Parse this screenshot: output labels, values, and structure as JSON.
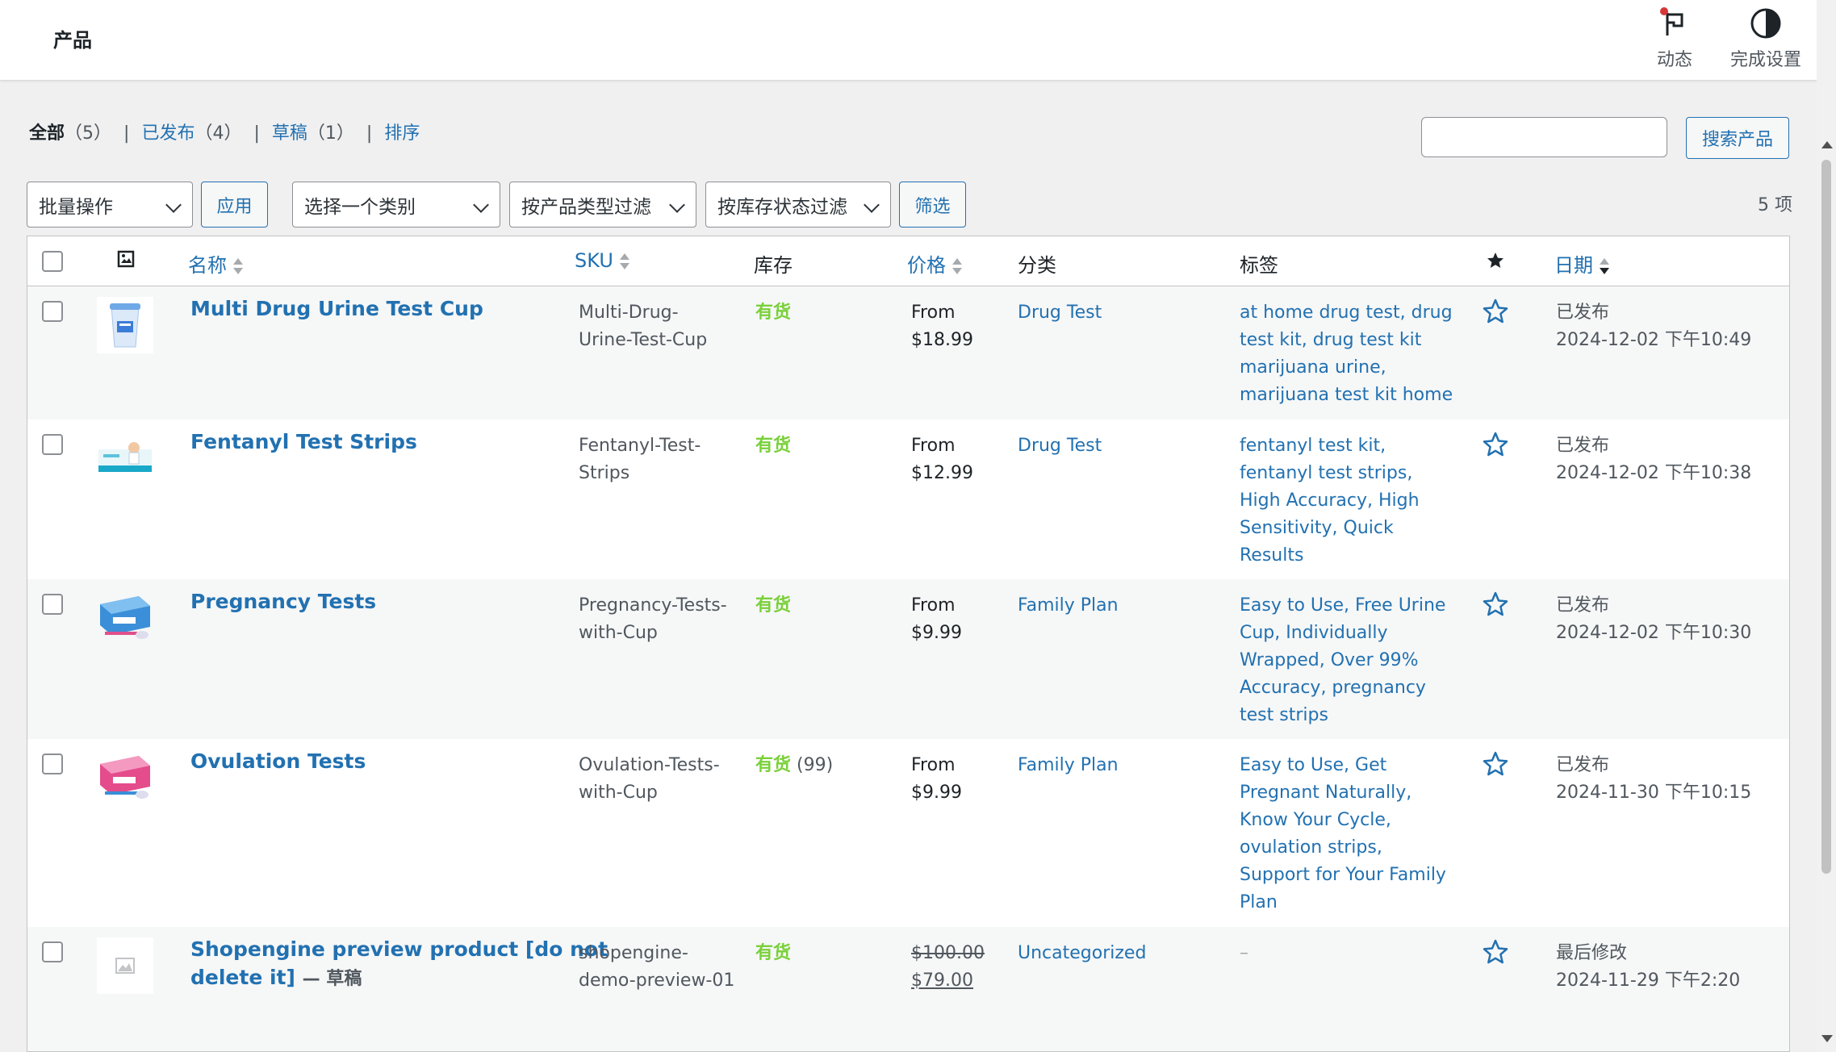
{
  "header": {
    "title": "产品",
    "actions": [
      {
        "label": "动态",
        "icon": "flag-icon"
      },
      {
        "label": "完成设置",
        "icon": "half-circle-icon"
      }
    ]
  },
  "views": {
    "all": {
      "label": "全部",
      "count": "（5）"
    },
    "published": {
      "label": "已发布",
      "count": "（4）"
    },
    "draft": {
      "label": "草稿",
      "count": "（1）"
    },
    "sort": {
      "label": "排序"
    },
    "separator": "|"
  },
  "search": {
    "placeholder": "",
    "button": "搜索产品"
  },
  "filters": {
    "bulk_action": "批量操作",
    "apply": "应用",
    "category": "选择一个类别",
    "product_type": "按产品类型过滤",
    "stock_status": "按库存状态过滤",
    "filter": "筛选",
    "items_count": "5 项"
  },
  "table": {
    "columns": {
      "name": "名称",
      "sku": "SKU",
      "stock": "库存",
      "price": "价格",
      "category": "分类",
      "tags": "标签",
      "date": "日期"
    },
    "rows": [
      {
        "name": "Multi Drug Urine Test Cup",
        "sku": [
          "Multi-Drug-",
          "Urine-Test-Cup"
        ],
        "stock": "有货",
        "stock_qty": "",
        "price": [
          "From",
          "$18.99"
        ],
        "category": "Drug Test",
        "tags": [
          "at home drug test, drug",
          "test kit, drug test kit",
          "marijuana urine,",
          "marijuana test kit home"
        ],
        "status": "已发布",
        "date": "2024-12-02 下午10:49"
      },
      {
        "name": "Fentanyl Test Strips",
        "sku": [
          "Fentanyl-Test-",
          "Strips"
        ],
        "stock": "有货",
        "stock_qty": "",
        "price": [
          "From",
          "$12.99"
        ],
        "category": "Drug Test",
        "tags": [
          "fentanyl test kit,",
          "fentanyl test strips,",
          "High Accuracy, High",
          "Sensitivity, Quick",
          "Results"
        ],
        "status": "已发布",
        "date": "2024-12-02 下午10:38"
      },
      {
        "name": "Pregnancy Tests",
        "sku": [
          "Pregnancy-Tests-",
          "with-Cup"
        ],
        "stock": "有货",
        "stock_qty": "",
        "price": [
          "From",
          "$9.99"
        ],
        "category": "Family Plan",
        "tags": [
          "Easy to Use, Free Urine",
          "Cup, Individually",
          "Wrapped, Over 99%",
          "Accuracy, pregnancy",
          "test strips"
        ],
        "status": "已发布",
        "date": "2024-12-02 下午10:30"
      },
      {
        "name": "Ovulation Tests",
        "sku": [
          "Ovulation-Tests-",
          "with-Cup"
        ],
        "stock": "有货",
        "stock_qty": "(99)",
        "price": [
          "From",
          "$9.99"
        ],
        "category": "Family Plan",
        "tags": [
          "Easy to Use, Get",
          "Pregnant Naturally,",
          "Know Your Cycle,",
          "ovulation strips,",
          "Support for Your Family",
          "Plan"
        ],
        "status": "已发布",
        "date": "2024-11-30 下午10:15"
      },
      {
        "name_line1": "Shopengine preview product [do not",
        "name_line2": "delete it]",
        "draft_label": "— 草稿",
        "sku": [
          "shopengine-",
          "demo-preview-01"
        ],
        "stock": "有货",
        "stock_qty": "",
        "price_old": "$100.00",
        "price_new": "$79.00",
        "category": "Uncategorized",
        "tags_empty": "–",
        "status": "最后修改",
        "date": "2024-11-29 下午2:20"
      }
    ]
  },
  "colors": {
    "link": "#2271b1",
    "instock": "#7ad03a",
    "text": "#1d2327",
    "muted": "#50575e"
  }
}
